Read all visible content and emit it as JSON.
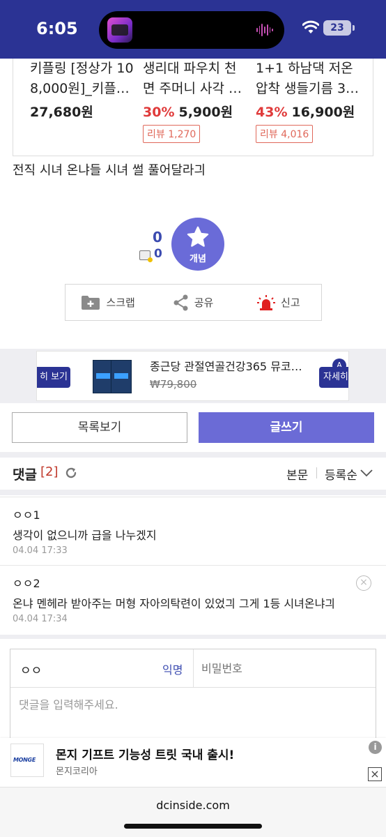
{
  "status_bar": {
    "time": "6:05",
    "battery": "23"
  },
  "products": [
    {
      "name_line1": "키플링 [정상가 10",
      "name_line2": "8,000원]_키플…",
      "discount": "",
      "price": "27,680원",
      "review": ""
    },
    {
      "name_line1": "생리대 파우치 천",
      "name_line2": "면 주머니 사각 …",
      "discount": "30%",
      "price": "5,900원",
      "review": "리뷰 1,270"
    },
    {
      "name_line1": "1+1 하남댁 저온",
      "name_line2": "압착 생들기름 3…",
      "discount": "43%",
      "price": "16,900원",
      "review": "리뷰 4,016"
    }
  ],
  "post": {
    "text": "전직 시녀 온냐들 시녀 썰 풀어달라긔"
  },
  "recommend": {
    "up_count": "0",
    "fixed_count": "0",
    "button_label": "개념"
  },
  "actions": {
    "scrap": "스크랩",
    "share": "공유",
    "report": "신고"
  },
  "ad_banner": {
    "left_button": "히 보기",
    "title": "종근당 관절연골건강365 뮤코…",
    "price": "₩79,800",
    "right_button": "자세히",
    "badge": "A"
  },
  "buttons": {
    "list": "목록보기",
    "write": "글쓰기"
  },
  "comments_header": {
    "title": "댓글",
    "count": "[2]",
    "option_body": "본문",
    "option_sort": "등록순"
  },
  "comments": [
    {
      "author": "ㅇㅇ1",
      "text": "생각이 없으니까 급을 나누겠지",
      "date": "04.04 17:33"
    },
    {
      "author": "ㅇㅇ2",
      "text": "온냐 멘헤라 받아주는 머형 자아의탁련이 있었긔 그게 1등 시녀온냐긔",
      "date": "04.04 17:34",
      "delete": "×"
    }
  ],
  "comment_write": {
    "nickname": "ㅇㅇ",
    "anon_label": "익명",
    "password_placeholder": "비밀번호",
    "placeholder": "댓글을 입력해주세요."
  },
  "bottom_ad": {
    "logo_text": "MONGE",
    "title": "몬지 기프트 기능성 트릿 국내 출시!",
    "advertiser": "몬지코리아",
    "info": "i",
    "close": "×"
  },
  "footer": {
    "url": "dcinside.com"
  },
  "colors": {
    "status_bar": "#2b3394",
    "accent": "#6b6bd6",
    "discount": "#e03b3b",
    "comment_count": "#c0392b"
  }
}
